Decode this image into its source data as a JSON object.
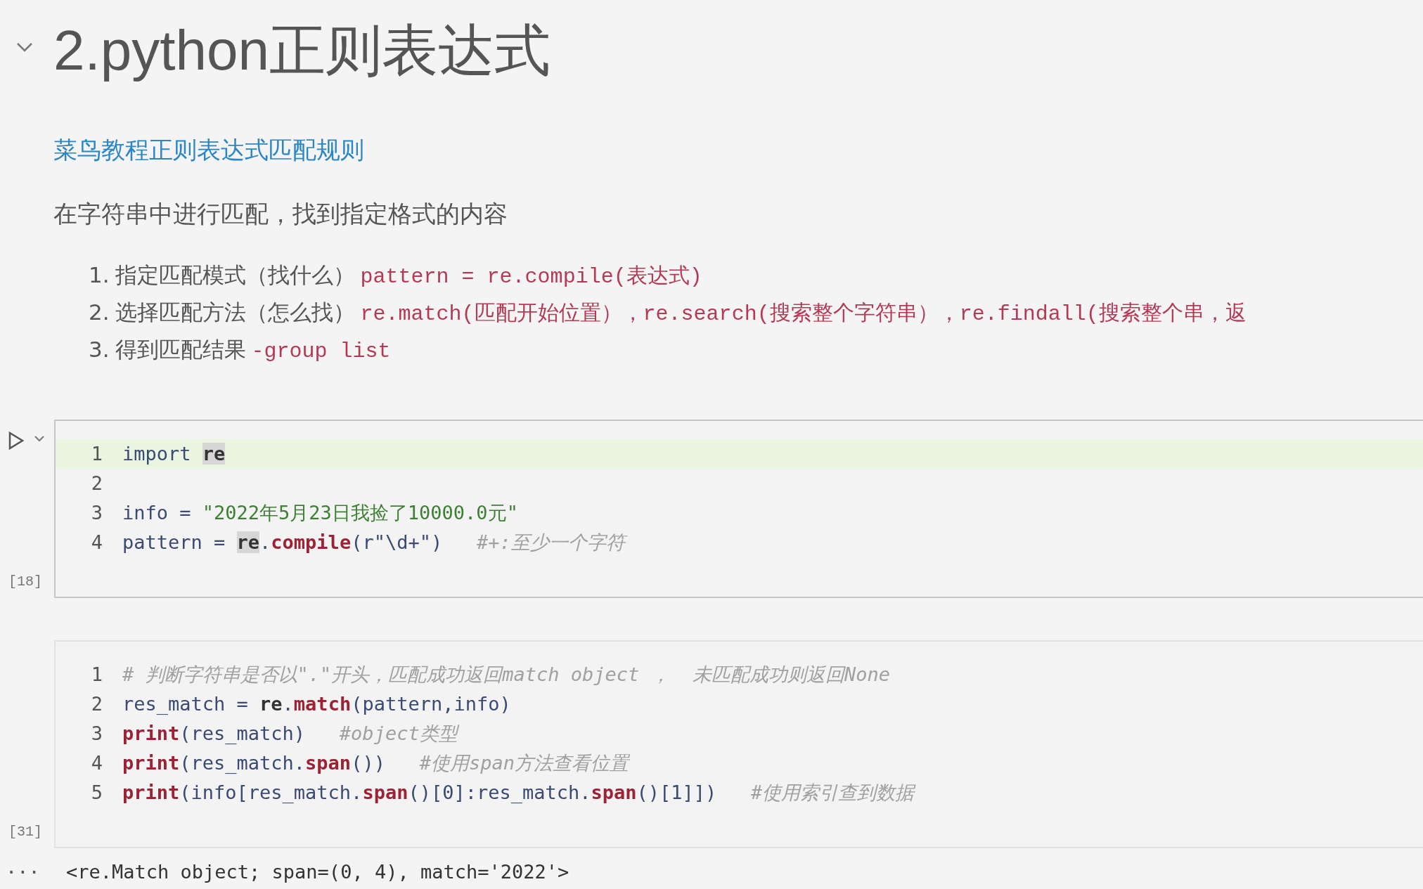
{
  "heading": {
    "text": "2.python正则表达式",
    "expanded": true
  },
  "link": "菜鸟教程正则表达式匹配规则",
  "paragraph": "在字符串中进行匹配，找到指定格式的内容",
  "steps": [
    {
      "number": "1.",
      "text": "指定匹配模式（找什么）",
      "code": "pattern = re.compile(表达式)"
    },
    {
      "number": "2.",
      "text": "选择匹配方法（怎么找）",
      "code": "re.match(匹配开始位置），re.search(搜索整个字符串），re.findall(搜索整个串，返"
    },
    {
      "number": "3.",
      "text": "得到匹配结果",
      "code": "-group list"
    }
  ],
  "cells": [
    {
      "focused": true,
      "execution_count": "[18]",
      "lines": [
        {
          "number": "1",
          "current": true,
          "tokens": [
            {
              "text": "import ",
              "kind": "keyword"
            },
            {
              "text": "re",
              "kind": "reference"
            }
          ]
        },
        {
          "number": "2",
          "current": false
        },
        {
          "number": "3",
          "current": false,
          "tokens": [
            {
              "text": "info = ",
              "kind": "plain"
            },
            {
              "text": "\"2022年5月23日我捡了10000.0元\"",
              "kind": "string"
            }
          ]
        },
        {
          "number": "4",
          "current": false,
          "tokens": [
            {
              "text": "pattern = ",
              "kind": "plain"
            },
            {
              "text": "re",
              "kind": "reference"
            },
            {
              "text": ".",
              "kind": "plain"
            },
            {
              "text": "compile",
              "kind": "function"
            },
            {
              "text": "(r\"\\d+\")   ",
              "kind": "plain"
            },
            {
              "text": "#+:至少一个字符",
              "kind": "comment"
            }
          ]
        }
      ]
    },
    {
      "focused": false,
      "execution_count": "[31]",
      "lines": [
        {
          "number": "1",
          "current": false,
          "tokens": [
            {
              "text": "# 判断字符串是否以\".\"开头，匹配成功返回match object ，  未匹配成功则返回None",
              "kind": "comment"
            }
          ]
        },
        {
          "number": "2",
          "current": false,
          "tokens": [
            {
              "text": "res_match = ",
              "kind": "plain"
            },
            {
              "text": "re",
              "kind": "module"
            },
            {
              "text": ".",
              "kind": "plain"
            },
            {
              "text": "match",
              "kind": "function"
            },
            {
              "text": "(pattern,info)",
              "kind": "plain"
            }
          ]
        },
        {
          "number": "3",
          "current": false,
          "tokens": [
            {
              "text": "print",
              "kind": "function"
            },
            {
              "text": "(res_match)   ",
              "kind": "plain"
            },
            {
              "text": "#object类型",
              "kind": "comment"
            }
          ]
        },
        {
          "number": "4",
          "current": false,
          "tokens": [
            {
              "text": "print",
              "kind": "function"
            },
            {
              "text": "(res_match.",
              "kind": "plain"
            },
            {
              "text": "span",
              "kind": "function"
            },
            {
              "text": "())   ",
              "kind": "plain"
            },
            {
              "text": "#使用span方法查看位置",
              "kind": "comment"
            }
          ]
        },
        {
          "number": "5",
          "current": false,
          "tokens": [
            {
              "text": "print",
              "kind": "function"
            },
            {
              "text": "(info[res_match.",
              "kind": "plain"
            },
            {
              "text": "span",
              "kind": "function"
            },
            {
              "text": "()[0]:res_match.",
              "kind": "plain"
            },
            {
              "text": "span",
              "kind": "function"
            },
            {
              "text": "()[1]])   ",
              "kind": "plain"
            },
            {
              "text": "#使用索引查到数据",
              "kind": "comment"
            }
          ]
        }
      ]
    }
  ],
  "output": {
    "marker": "···",
    "text": "<re.Match object; span=(0, 4), match='2022'>"
  }
}
